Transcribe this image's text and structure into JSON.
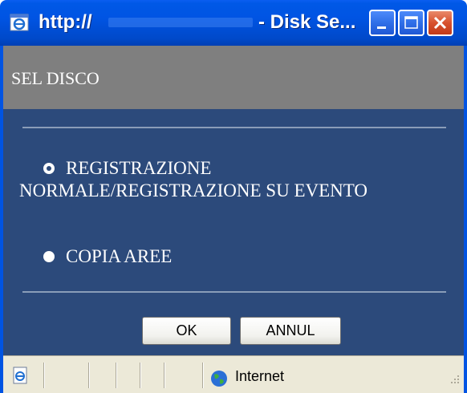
{
  "window": {
    "title_prefix": "http://",
    "title_suffix": "- Disk Se...",
    "buttons": [
      "minimize",
      "maximize",
      "close"
    ]
  },
  "header": {
    "title": "SEL DISCO"
  },
  "options": [
    {
      "label": "REGISTRAZIONE NORMALE/REGISTRAZIONE SU EVENTO",
      "selected": true
    },
    {
      "label": "COPIA AREE",
      "selected": false
    }
  ],
  "buttons": {
    "ok": "OK",
    "cancel": "ANNUL"
  },
  "statusbar": {
    "zone": "Internet"
  },
  "colors": {
    "titlebar": "#0054e3",
    "header": "#7f7f7f",
    "panel": "#2c4a7b",
    "statusbar": "#ece9d8"
  },
  "icons": [
    "ie-icon",
    "minimize-icon",
    "maximize-icon",
    "close-icon",
    "page-icon",
    "globe-icon",
    "resize-grip-icon"
  ]
}
